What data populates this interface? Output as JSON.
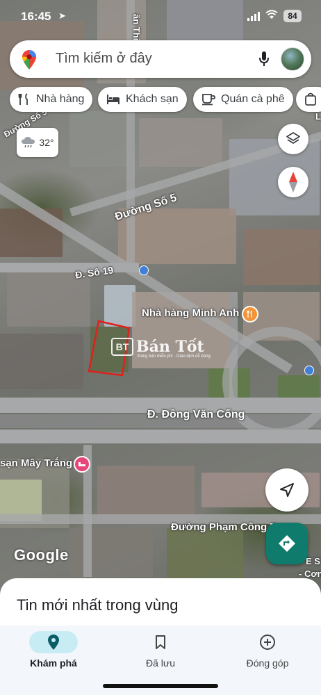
{
  "status_bar": {
    "time": "16:45",
    "battery": "84"
  },
  "search": {
    "placeholder": "Tìm kiếm ở đây"
  },
  "chips": [
    {
      "label": "Nhà hàng",
      "icon": "restaurant-icon"
    },
    {
      "label": "Khách sạn",
      "icon": "hotel-icon"
    },
    {
      "label": "Quán cà phê",
      "icon": "coffee-icon"
    },
    {
      "label": "",
      "icon": "shopping-bag-icon"
    }
  ],
  "weather": {
    "temp": "32°"
  },
  "map_labels": {
    "street_top_left": "Đường Số 5",
    "street_mid": "Đường Số 5",
    "street_19": "Đ. Số 19",
    "restaurant": "Nhà hàng Minh Anh",
    "dong_van_cong": "Đ. Đồng Văn Cống",
    "hotel": "sạn Mây Trắng",
    "pham_cong_tru": "Đường Phạm Công Tr",
    "top_road": "ăn Thinh",
    "edge_right_1": "E S",
    "edge_right_2": "- Cơn",
    "edge_top_right": "L"
  },
  "watermark": {
    "name": "Bán Tốt",
    "logo": "BT",
    "tagline": "Đăng bán miễn phí - Giao dịch dễ dàng"
  },
  "google_logo": "Google",
  "sheet": {
    "title": "Tin mới nhất trong vùng"
  },
  "bottom_nav": [
    {
      "label": "Khám phá",
      "icon": "explore-pin-icon",
      "active": true
    },
    {
      "label": "Đã lưu",
      "icon": "bookmark-icon",
      "active": false
    },
    {
      "label": "Đóng góp",
      "icon": "add-circle-icon",
      "active": false
    }
  ],
  "colors": {
    "accent": "#0f7b6d",
    "active_tab": "#c8ecf4",
    "hotel_pin": "#e8457a",
    "restaurant_pin": "#f29437",
    "parcel_outline": "#e0201b"
  }
}
